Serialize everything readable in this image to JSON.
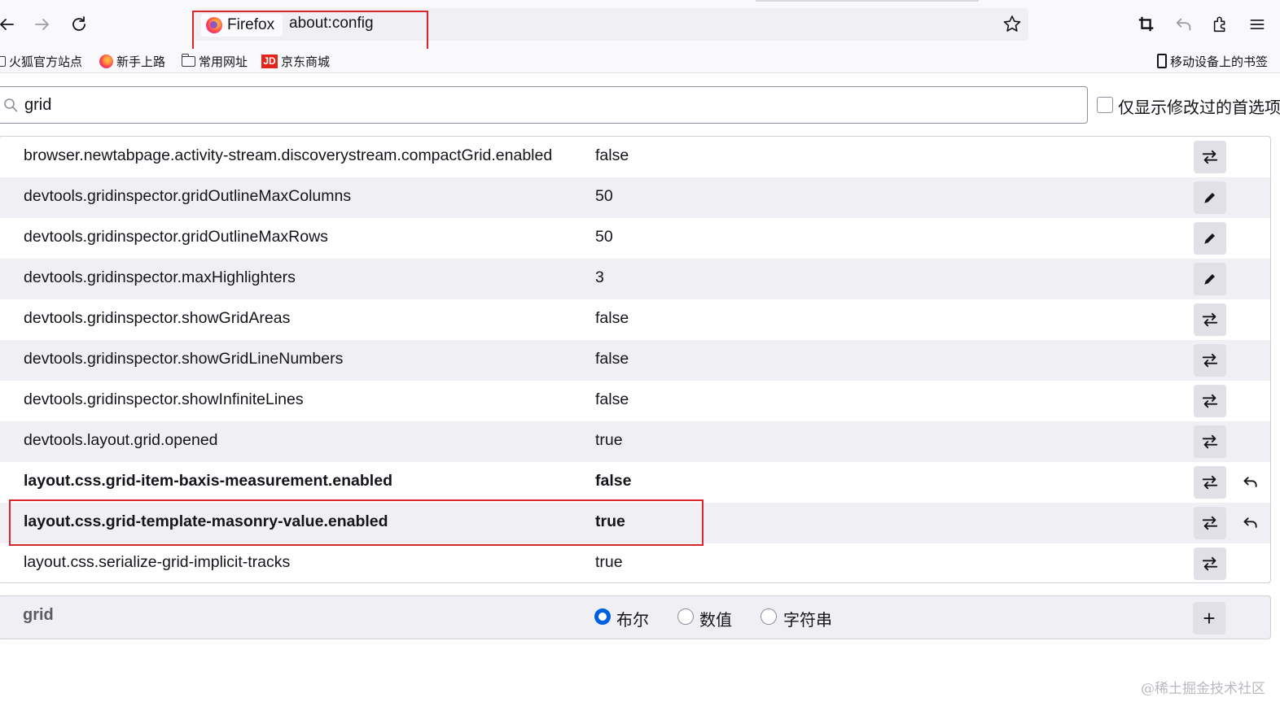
{
  "colors": {
    "highlight_border": "#d9262b",
    "accent": "#0061e0",
    "row_alt": "#f0f0f4",
    "button_bg": "#e0e0e6"
  },
  "toolbar": {
    "identity_label": "Firefox",
    "url": "about:config",
    "icons": [
      "back-icon",
      "forward-icon",
      "reload-icon",
      "bookmark-star-icon",
      "crop-icon",
      "undo-icon",
      "extensions-icon",
      "menu-icon"
    ]
  },
  "bookmarks": {
    "items": [
      {
        "label": "火狐官方站点",
        "icon": "folder-icon"
      },
      {
        "label": "新手上路",
        "icon": "firefox-icon"
      },
      {
        "label": "常用网址",
        "icon": "folder-icon"
      },
      {
        "label": "京东商城",
        "icon": "jd-icon",
        "icon_text": "JD"
      }
    ],
    "mobile_label": "移动设备上的书签"
  },
  "search": {
    "value": "grid",
    "show_modified_label": "仅显示修改过的首选项",
    "show_modified_checked": false
  },
  "prefs": [
    {
      "name": "browser.newtabpage.activity-stream.discoverystream.compactGrid.enabled",
      "value": "false",
      "action": "toggle",
      "modified": false
    },
    {
      "name": "devtools.gridinspector.gridOutlineMaxColumns",
      "value": "50",
      "action": "edit",
      "modified": false
    },
    {
      "name": "devtools.gridinspector.gridOutlineMaxRows",
      "value": "50",
      "action": "edit",
      "modified": false
    },
    {
      "name": "devtools.gridinspector.maxHighlighters",
      "value": "3",
      "action": "edit",
      "modified": false
    },
    {
      "name": "devtools.gridinspector.showGridAreas",
      "value": "false",
      "action": "toggle",
      "modified": false
    },
    {
      "name": "devtools.gridinspector.showGridLineNumbers",
      "value": "false",
      "action": "toggle",
      "modified": false
    },
    {
      "name": "devtools.gridinspector.showInfiniteLines",
      "value": "false",
      "action": "toggle",
      "modified": false
    },
    {
      "name": "devtools.layout.grid.opened",
      "value": "true",
      "action": "toggle",
      "modified": false
    },
    {
      "name": "layout.css.grid-item-baxis-measurement.enabled",
      "value": "false",
      "action": "toggle",
      "modified": true
    },
    {
      "name": "layout.css.grid-template-masonry-value.enabled",
      "value": "true",
      "action": "toggle",
      "modified": true
    },
    {
      "name": "layout.css.serialize-grid-implicit-tracks",
      "value": "true",
      "action": "toggle",
      "modified": false
    }
  ],
  "add_row": {
    "name": "grid",
    "types": [
      {
        "label": "布尔",
        "checked": true
      },
      {
        "label": "数值",
        "checked": false
      },
      {
        "label": "字符串",
        "checked": false
      }
    ],
    "add_symbol": "+"
  },
  "watermark": "@稀土掘金技术社区"
}
